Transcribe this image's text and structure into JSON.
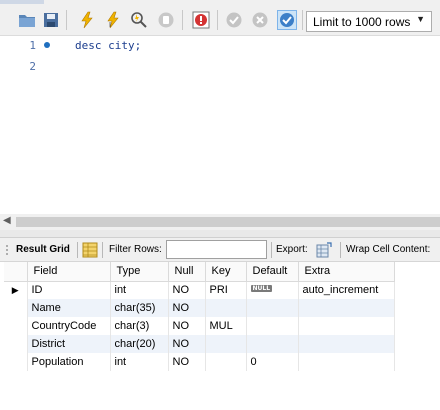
{
  "toolbar": {
    "icons": [
      "open-folder-icon",
      "save-icon",
      "execute-icon",
      "execute-current-icon",
      "explain-icon",
      "stop-icon",
      "toggle-continue-on-error-icon",
      "commit-icon",
      "rollback-icon",
      "autocommit-icon"
    ],
    "limit_label": "Limit to 1000 rows"
  },
  "editor": {
    "line_numbers": [
      "1",
      "2"
    ],
    "lines": [
      "desc city;",
      ""
    ]
  },
  "result_toolbar": {
    "result_grid_label": "Result Grid",
    "filter_rows_label": "Filter Rows:",
    "filter_value": "",
    "export_label": "Export:",
    "wrap_label": "Wrap Cell Content:"
  },
  "grid": {
    "columns": [
      "Field",
      "Type",
      "Null",
      "Key",
      "Default",
      "Extra"
    ],
    "rows": [
      {
        "field": "ID",
        "type": "int",
        "null": "NO",
        "key": "PRI",
        "default": "NULL",
        "extra": "auto_increment"
      },
      {
        "field": "Name",
        "type": "char(35)",
        "null": "NO",
        "key": "",
        "default": "",
        "extra": ""
      },
      {
        "field": "CountryCode",
        "type": "char(3)",
        "null": "NO",
        "key": "MUL",
        "default": "",
        "extra": ""
      },
      {
        "field": "District",
        "type": "char(20)",
        "null": "NO",
        "key": "",
        "default": "",
        "extra": ""
      },
      {
        "field": "Population",
        "type": "int",
        "null": "NO",
        "key": "",
        "default": "0",
        "extra": ""
      }
    ]
  }
}
